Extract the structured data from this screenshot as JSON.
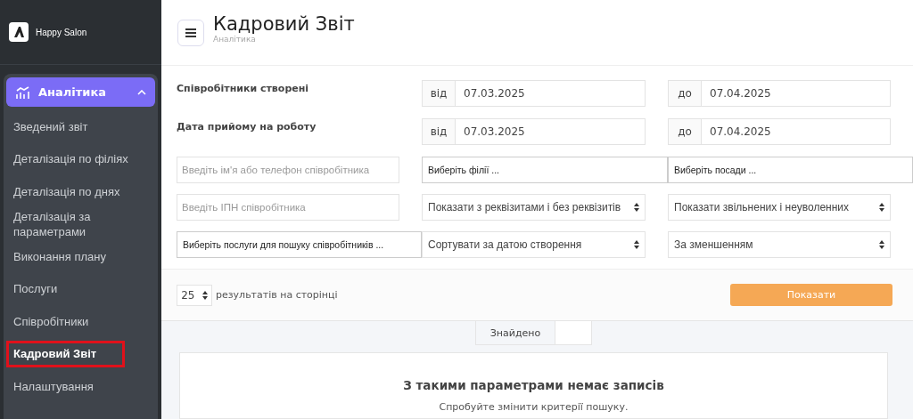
{
  "brand": {
    "name": "Happy Salon"
  },
  "sidebar": {
    "group": {
      "label": "Аналітика",
      "expanded": true
    },
    "items": [
      {
        "label": "Зведений звіт",
        "selected": false
      },
      {
        "label": "Деталізація по філіях",
        "selected": false
      },
      {
        "label": "Деталізація по днях",
        "selected": false
      },
      {
        "label": "Деталізація за параметрами",
        "selected": false
      },
      {
        "label": "Виконання плану",
        "selected": false
      },
      {
        "label": "Послуги",
        "selected": false
      },
      {
        "label": "Співробітники",
        "selected": false
      },
      {
        "label": "Кадровий Звіт",
        "selected": true
      },
      {
        "label": "Налаштування",
        "selected": false
      }
    ]
  },
  "header": {
    "title": "Кадровий Звіт",
    "breadcrumb": "Аналітика"
  },
  "filters": {
    "date_rows": [
      {
        "label": "Співробітники створені",
        "from_prefix": "від",
        "from": "07.03.2025",
        "to_prefix": "до",
        "to": "07.04.2025"
      },
      {
        "label": "Дата прийому на роботу",
        "from_prefix": "від",
        "from": "07.03.2025",
        "to_prefix": "до",
        "to": "07.04.2025"
      }
    ],
    "controls": [
      {
        "kind": "input",
        "placeholder": "Введіть ім'я або телефон співробітника"
      },
      {
        "kind": "multiselect",
        "placeholder": "Виберіть філії ..."
      },
      {
        "kind": "multiselect",
        "placeholder": "Виберіть посади ..."
      },
      {
        "kind": "input",
        "placeholder": "Введіть ІПН співробітника"
      },
      {
        "kind": "select",
        "value": "Показати з реквізитами і без реквізитів"
      },
      {
        "kind": "select",
        "value": "Показати звільнених і неуволенних"
      },
      {
        "kind": "multiselect",
        "placeholder": "Виберіть послуги для пошуку співробітників ..."
      },
      {
        "kind": "select",
        "value": "Сортувати за датою створення"
      },
      {
        "kind": "select",
        "value": "За зменшенням"
      }
    ]
  },
  "pagination": {
    "per_page": "25",
    "label": "результатів на сторінці",
    "button": "Показати"
  },
  "results": {
    "found_label": "Знайдено",
    "empty_title": "З такими параметрами немає записів",
    "empty_hint": "Спробуйте змінити критерії пошуку."
  }
}
